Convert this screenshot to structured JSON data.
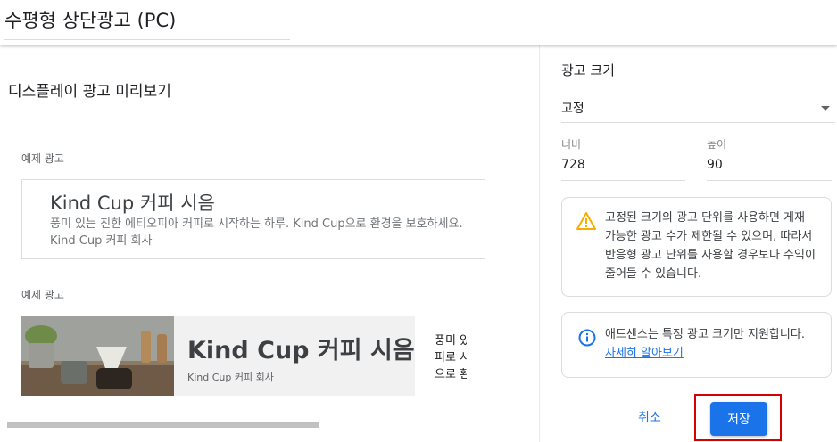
{
  "header": {
    "title": "수평형 상단광고 (PC)"
  },
  "preview": {
    "title": "디스플레이 광고 미리보기",
    "example1": {
      "label": "예제 광고",
      "headline": "Kind Cup 커피 시음",
      "description": "풍미 있는 진한 에티오피아 커피로 시작하는 하루. Kind Cup으로 환경을 보호하세요. Kind Cup 커피 회사"
    },
    "example2": {
      "label": "예제 광고",
      "headline": "Kind Cup 커피 시음",
      "company": "Kind Cup 커피 회사",
      "side_lines": [
        "풍미 있",
        "피로 시",
        "으로 환"
      ]
    }
  },
  "settings": {
    "title": "광고 크기",
    "size_type": "고정",
    "width_label": "너비",
    "width_value": "728",
    "height_label": "높이",
    "height_value": "90",
    "warning_text": "고정된 크기의 광고 단위를 사용하면 게재 가능한 광고 수가 제한될 수 있으며, 따라서 반응형 광고 단위를 사용할 경우보다 수익이 줄어들 수 있습니다.",
    "info_text": "애드센스는 특정 광고 크기만 지원합니다.",
    "info_link": "자세히 알아보기",
    "cancel_label": "취소",
    "save_label": "저장"
  },
  "colors": {
    "accent": "#1a73e8",
    "warning": "#f9ab00",
    "highlight": "#d50000"
  }
}
